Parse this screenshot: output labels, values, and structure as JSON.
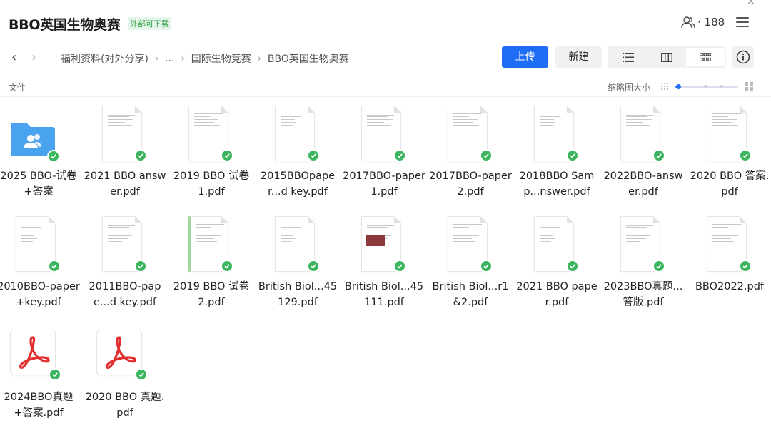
{
  "header": {
    "title": "BBO英国生物奥赛",
    "badge": "外部可下载",
    "member_count": "· 188",
    "close_glyph": "×"
  },
  "toolbar": {
    "back": "‹",
    "forward": "›",
    "breadcrumbs": [
      "福利资料(对外分享)",
      "...",
      "国际生物竞赛",
      "BBO英国生物奥赛"
    ],
    "upload_label": "上传",
    "new_label": "新建"
  },
  "list_header": {
    "column_label": "文件",
    "thumb_size_label": "缩略图大小",
    "thumb_size_value": 0.05
  },
  "icons": {
    "members": "user-group-icon",
    "menu": "hamburger-icon",
    "view_list": "list-view-icon",
    "view_columns": "column-view-icon",
    "view_grid": "grid-view-icon",
    "info": "info-icon",
    "synced": "check-icon",
    "folder": "folder-icon",
    "pdf": "pdf-icon"
  },
  "colors": {
    "accent": "#1f6cf5",
    "synced": "#3cb55f",
    "folder": "#4aa3ef",
    "pdf": "#e22e2e",
    "badge_text": "#2f9e44"
  },
  "files": [
    {
      "name": "2025 BBO-试卷+答案",
      "kind": "folder"
    },
    {
      "name": "2021 BBO answer.pdf",
      "kind": "doc"
    },
    {
      "name": "2019 BBO 试卷1.pdf",
      "kind": "doc"
    },
    {
      "name": "2015BBOpaper...d key.pdf",
      "kind": "doc"
    },
    {
      "name": "2017BBO-paper1.pdf",
      "kind": "doc"
    },
    {
      "name": "2017BBO-paper2.pdf",
      "kind": "doc"
    },
    {
      "name": "2018BBO Samp...nswer.pdf",
      "kind": "doc"
    },
    {
      "name": "2022BBO-answer.pdf",
      "kind": "doc"
    },
    {
      "name": "2020 BBO 答案.pdf",
      "kind": "doc"
    },
    {
      "name": "2010BBO-paper+key.pdf",
      "kind": "doc"
    },
    {
      "name": "2011BBO-pape...d key.pdf",
      "kind": "doc"
    },
    {
      "name": "2019 BBO 试卷2.pdf",
      "kind": "doc-green"
    },
    {
      "name": "British Biol...45129.pdf",
      "kind": "doc"
    },
    {
      "name": "British Biol...45111.pdf",
      "kind": "doc-photo"
    },
    {
      "name": "British Biol...r1&2.pdf",
      "kind": "doc"
    },
    {
      "name": "2021 BBO paper.pdf",
      "kind": "doc"
    },
    {
      "name": "2023BBO真题...答版.pdf",
      "kind": "doc"
    },
    {
      "name": "BBO2022.pdf",
      "kind": "doc"
    },
    {
      "name": "2024BBO真题+答案.pdf",
      "kind": "pdf"
    },
    {
      "name": "2020 BBO 真题.pdf",
      "kind": "pdf"
    }
  ]
}
